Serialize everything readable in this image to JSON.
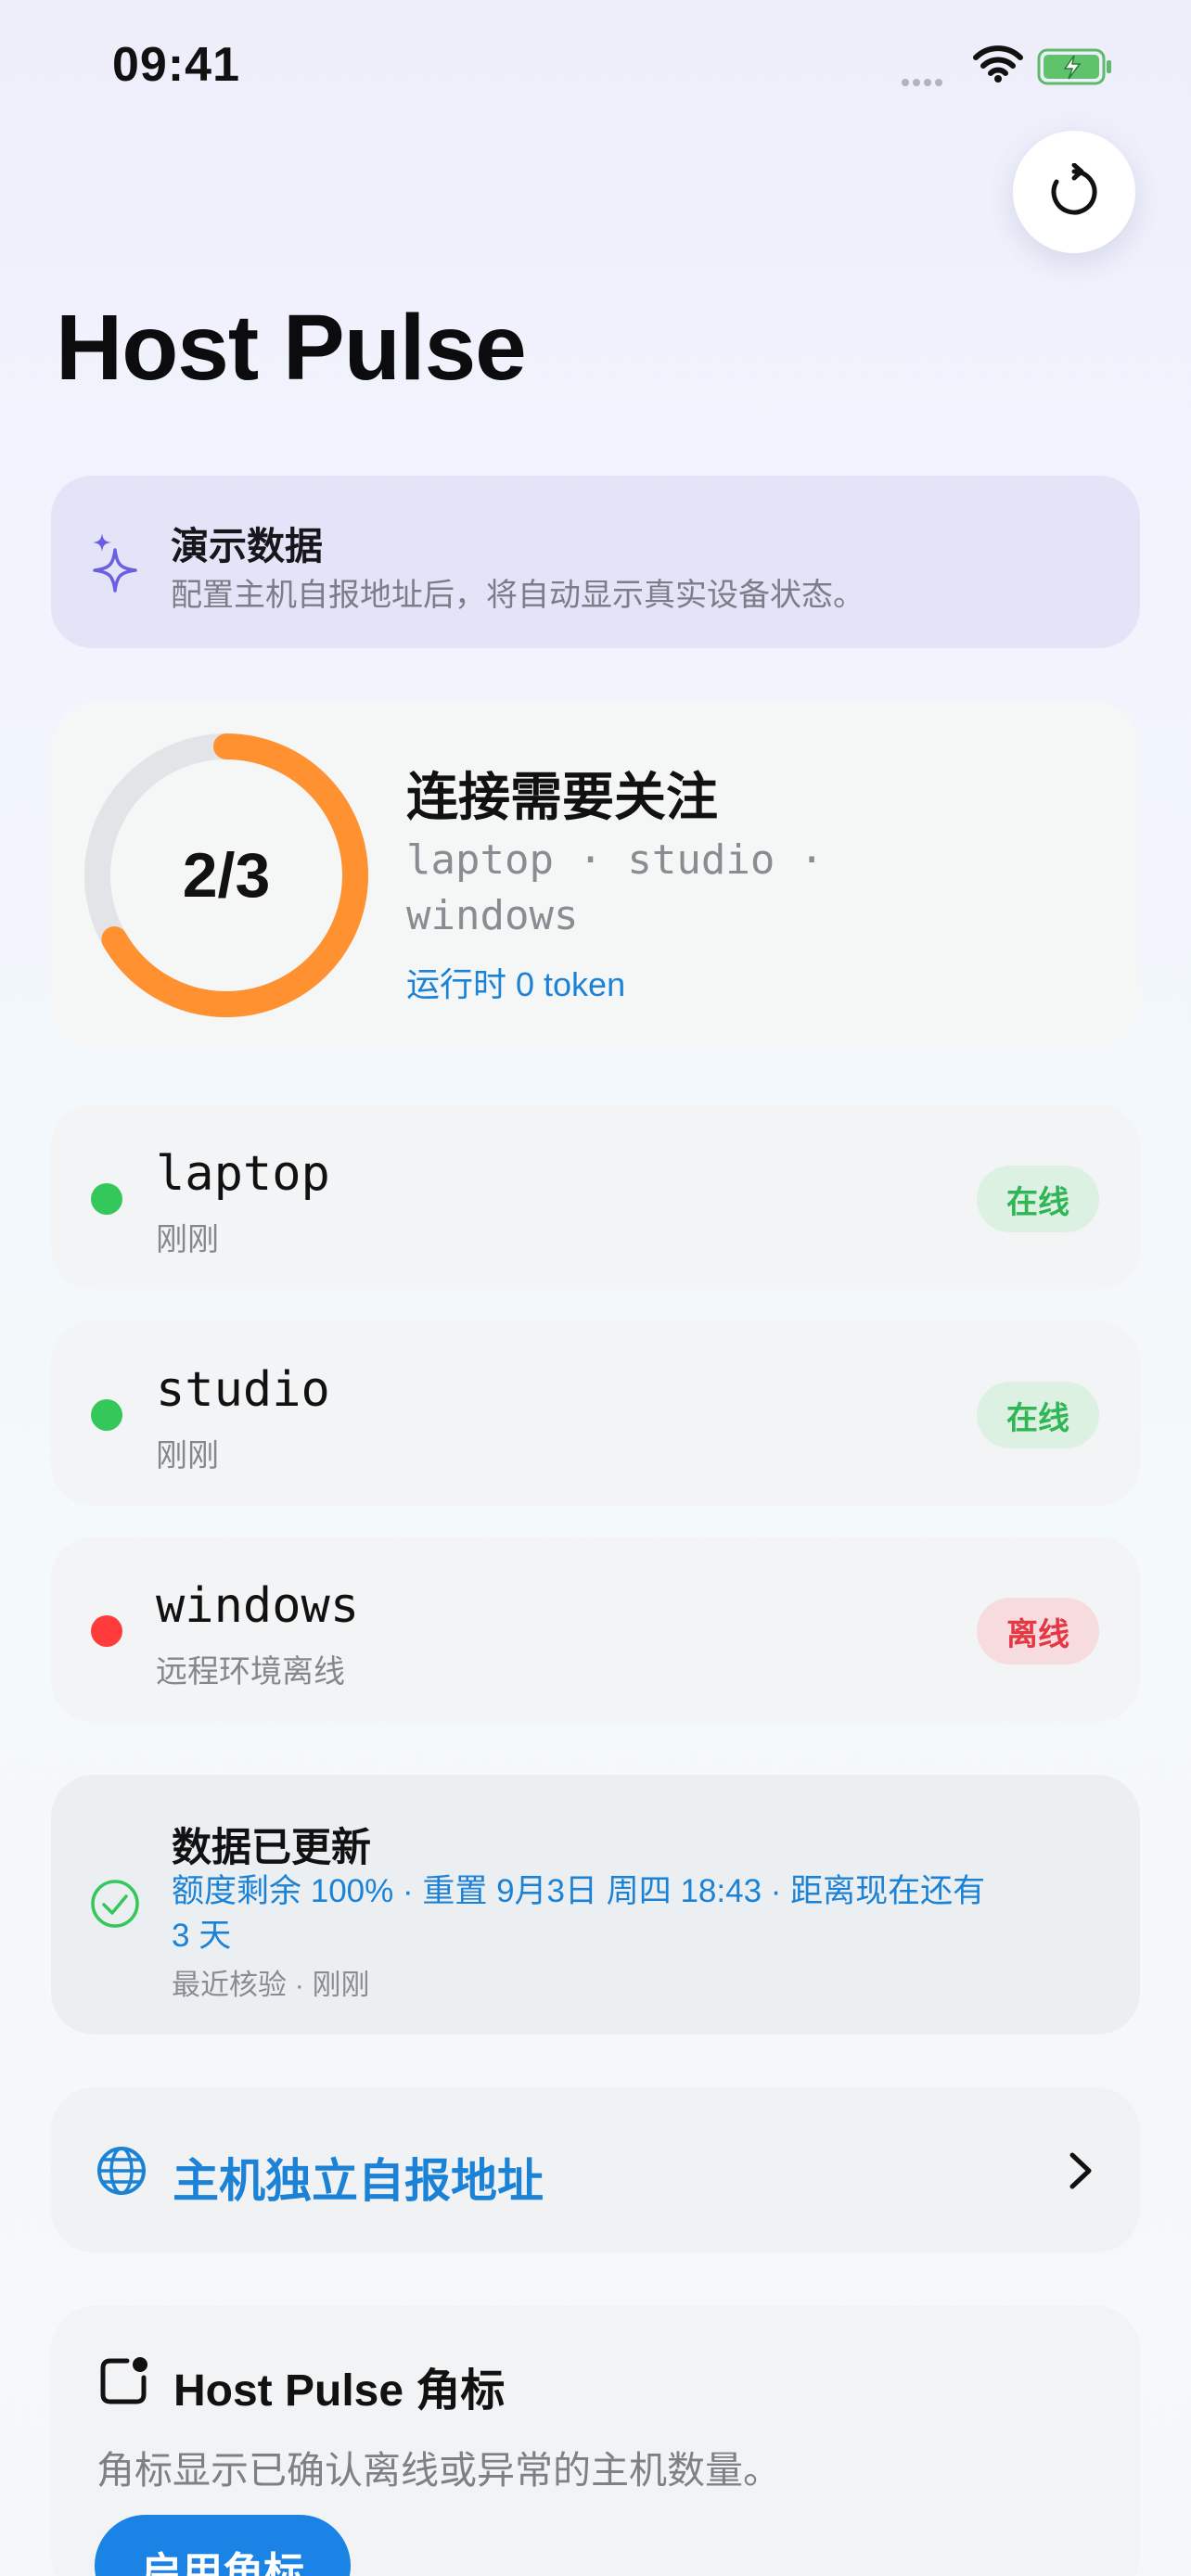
{
  "status_bar": {
    "time": "09:41"
  },
  "app": {
    "title": "Host Pulse"
  },
  "demo": {
    "title": "演示数据",
    "subtitle": "配置主机自报地址后，将自动显示真实设备状态。"
  },
  "summary": {
    "ring_label": "2/3",
    "ring_fraction": 0.667,
    "title": "连接需要关注",
    "hosts_line": "laptop · studio · windows",
    "runtime": "运行时 0 token"
  },
  "hosts": [
    {
      "name": "laptop",
      "detail": "刚刚",
      "status": "在线",
      "status_color": "#30b656"
    },
    {
      "name": "studio",
      "detail": "刚刚",
      "status": "在线",
      "status_color": "#30b656"
    },
    {
      "name": "windows",
      "detail": "远程环境离线",
      "status": "离线",
      "status_color": "#e53744"
    }
  ],
  "update": {
    "title": "数据已更新",
    "detail": "额度剩余 100% · 重置 9月3日 周四 18:43 · 距离现在还有 3 天",
    "meta": "最近核验 · 刚刚"
  },
  "link": {
    "label": "主机独立自报地址"
  },
  "badge_section": {
    "title": "Host Pulse 角标",
    "description": "角标显示已确认离线或异常的主机数量。",
    "button_label": "启用角标"
  },
  "colors": {
    "accent": "#1b82d6",
    "ring": "#ff9130",
    "online": "#30b656",
    "offline": "#e53744"
  }
}
